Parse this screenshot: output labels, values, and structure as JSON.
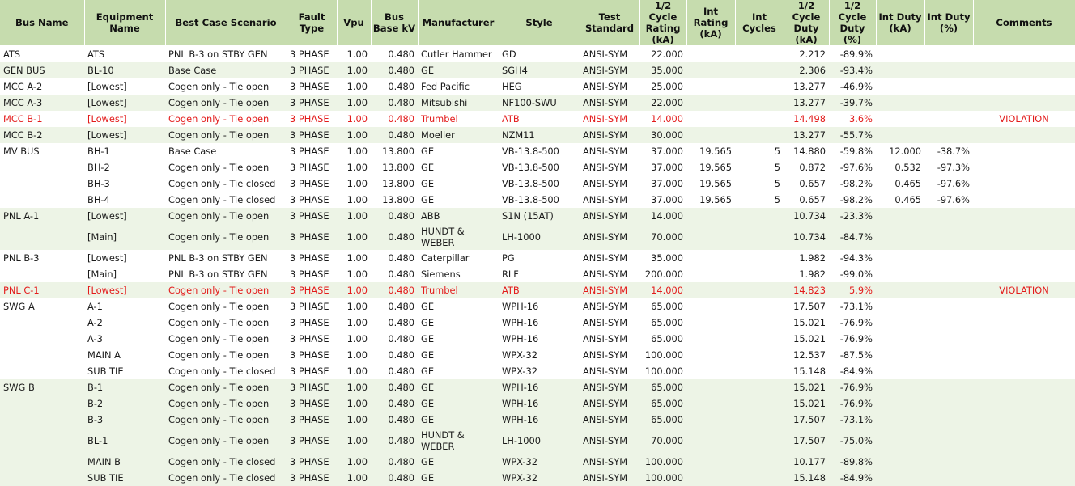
{
  "table": {
    "columns": [
      "Bus Name",
      "Equipment Name",
      "Best Case Scenario",
      "Fault Type",
      "Vpu",
      "Bus Base kV",
      "Manufacturer",
      "Style",
      "Test Standard",
      "1/2 Cycle Rating (kA)",
      "Int Rating (kA)",
      "Int Cycles",
      "1/2 Cycle Duty (kA)",
      "1/2 Cycle Duty (%)",
      "Int Duty (kA)",
      "Int Duty (%)",
      "Comments"
    ],
    "rows": [
      {
        "cells": [
          "ATS",
          "ATS",
          "PNL B-3 on STBY GEN",
          "3 PHASE",
          "1.00",
          "0.480",
          "Cutler Hammer",
          "GD",
          "ANSI-SYM",
          "22.000",
          "",
          "",
          "2.212",
          "-89.9%",
          "",
          "",
          ""
        ],
        "band": false,
        "violation": false,
        "tall": false
      },
      {
        "cells": [
          "GEN BUS",
          "BL-10",
          "Base Case",
          "3 PHASE",
          "1.00",
          "0.480",
          "GE",
          "SGH4",
          "ANSI-SYM",
          "35.000",
          "",
          "",
          "2.306",
          "-93.4%",
          "",
          "",
          ""
        ],
        "band": true,
        "violation": false,
        "tall": false
      },
      {
        "cells": [
          "MCC A-2",
          "[Lowest]",
          "Cogen only - Tie open",
          "3 PHASE",
          "1.00",
          "0.480",
          "Fed Pacific",
          "HEG",
          "ANSI-SYM",
          "25.000",
          "",
          "",
          "13.277",
          "-46.9%",
          "",
          "",
          ""
        ],
        "band": false,
        "violation": false,
        "tall": false
      },
      {
        "cells": [
          "MCC A-3",
          "[Lowest]",
          "Cogen only - Tie open",
          "3 PHASE",
          "1.00",
          "0.480",
          "Mitsubishi",
          "NF100-SWU",
          "ANSI-SYM",
          "22.000",
          "",
          "",
          "13.277",
          "-39.7%",
          "",
          "",
          ""
        ],
        "band": true,
        "violation": false,
        "tall": false
      },
      {
        "cells": [
          "MCC B-1",
          "[Lowest]",
          "Cogen only - Tie open",
          "3 PHASE",
          "1.00",
          "0.480",
          "Trumbel",
          "ATB",
          "ANSI-SYM",
          "14.000",
          "",
          "",
          "14.498",
          "3.6%",
          "",
          "",
          "VIOLATION"
        ],
        "band": false,
        "violation": true,
        "tall": false
      },
      {
        "cells": [
          "MCC B-2",
          "[Lowest]",
          "Cogen only - Tie open",
          "3 PHASE",
          "1.00",
          "0.480",
          "Moeller",
          "NZM11",
          "ANSI-SYM",
          "30.000",
          "",
          "",
          "13.277",
          "-55.7%",
          "",
          "",
          ""
        ],
        "band": true,
        "violation": false,
        "tall": false
      },
      {
        "cells": [
          "MV BUS",
          "BH-1",
          "Base Case",
          "3 PHASE",
          "1.00",
          "13.800",
          "GE",
          "VB-13.8-500",
          "ANSI-SYM",
          "37.000",
          "19.565",
          "5",
          "14.880",
          "-59.8%",
          "12.000",
          "-38.7%",
          ""
        ],
        "band": false,
        "violation": false,
        "tall": false
      },
      {
        "cells": [
          "",
          "BH-2",
          "Cogen only - Tie open",
          "3 PHASE",
          "1.00",
          "13.800",
          "GE",
          "VB-13.8-500",
          "ANSI-SYM",
          "37.000",
          "19.565",
          "5",
          "0.872",
          "-97.6%",
          "0.532",
          "-97.3%",
          ""
        ],
        "band": false,
        "violation": false,
        "tall": false
      },
      {
        "cells": [
          "",
          "BH-3",
          "Cogen only - Tie closed",
          "3 PHASE",
          "1.00",
          "13.800",
          "GE",
          "VB-13.8-500",
          "ANSI-SYM",
          "37.000",
          "19.565",
          "5",
          "0.657",
          "-98.2%",
          "0.465",
          "-97.6%",
          ""
        ],
        "band": false,
        "violation": false,
        "tall": false
      },
      {
        "cells": [
          "",
          "BH-4",
          "Cogen only - Tie closed",
          "3 PHASE",
          "1.00",
          "13.800",
          "GE",
          "VB-13.8-500",
          "ANSI-SYM",
          "37.000",
          "19.565",
          "5",
          "0.657",
          "-98.2%",
          "0.465",
          "-97.6%",
          ""
        ],
        "band": false,
        "violation": false,
        "tall": false
      },
      {
        "cells": [
          "PNL A-1",
          "[Lowest]",
          "Cogen only - Tie open",
          "3 PHASE",
          "1.00",
          "0.480",
          "ABB",
          "S1N (15AT)",
          "ANSI-SYM",
          "14.000",
          "",
          "",
          "10.734",
          "-23.3%",
          "",
          "",
          ""
        ],
        "band": true,
        "violation": false,
        "tall": false
      },
      {
        "cells": [
          "",
          "[Main]",
          "Cogen only - Tie open",
          "3 PHASE",
          "1.00",
          "0.480",
          "HUNDT & WEBER",
          "LH-1000",
          "ANSI-SYM",
          "70.000",
          "",
          "",
          "10.734",
          "-84.7%",
          "",
          "",
          ""
        ],
        "band": true,
        "violation": false,
        "tall": true
      },
      {
        "cells": [
          "PNL B-3",
          "[Lowest]",
          "PNL B-3 on STBY GEN",
          "3 PHASE",
          "1.00",
          "0.480",
          "Caterpillar",
          "PG",
          "ANSI-SYM",
          "35.000",
          "",
          "",
          "1.982",
          "-94.3%",
          "",
          "",
          ""
        ],
        "band": false,
        "violation": false,
        "tall": false
      },
      {
        "cells": [
          "",
          "[Main]",
          "PNL B-3 on STBY GEN",
          "3 PHASE",
          "1.00",
          "0.480",
          "Siemens",
          "RLF",
          "ANSI-SYM",
          "200.000",
          "",
          "",
          "1.982",
          "-99.0%",
          "",
          "",
          ""
        ],
        "band": false,
        "violation": false,
        "tall": false
      },
      {
        "cells": [
          "PNL C-1",
          "[Lowest]",
          "Cogen only - Tie open",
          "3 PHASE",
          "1.00",
          "0.480",
          "Trumbel",
          "ATB",
          "ANSI-SYM",
          "14.000",
          "",
          "",
          "14.823",
          "5.9%",
          "",
          "",
          "VIOLATION"
        ],
        "band": true,
        "violation": true,
        "tall": false
      },
      {
        "cells": [
          "SWG A",
          "A-1",
          "Cogen only - Tie open",
          "3 PHASE",
          "1.00",
          "0.480",
          "GE",
          "WPH-16",
          "ANSI-SYM",
          "65.000",
          "",
          "",
          "17.507",
          "-73.1%",
          "",
          "",
          ""
        ],
        "band": false,
        "violation": false,
        "tall": false
      },
      {
        "cells": [
          "",
          "A-2",
          "Cogen only - Tie open",
          "3 PHASE",
          "1.00",
          "0.480",
          "GE",
          "WPH-16",
          "ANSI-SYM",
          "65.000",
          "",
          "",
          "15.021",
          "-76.9%",
          "",
          "",
          ""
        ],
        "band": false,
        "violation": false,
        "tall": false
      },
      {
        "cells": [
          "",
          "A-3",
          "Cogen only - Tie open",
          "3 PHASE",
          "1.00",
          "0.480",
          "GE",
          "WPH-16",
          "ANSI-SYM",
          "65.000",
          "",
          "",
          "15.021",
          "-76.9%",
          "",
          "",
          ""
        ],
        "band": false,
        "violation": false,
        "tall": false
      },
      {
        "cells": [
          "",
          "MAIN A",
          "Cogen only - Tie open",
          "3 PHASE",
          "1.00",
          "0.480",
          "GE",
          "WPX-32",
          "ANSI-SYM",
          "100.000",
          "",
          "",
          "12.537",
          "-87.5%",
          "",
          "",
          ""
        ],
        "band": false,
        "violation": false,
        "tall": false
      },
      {
        "cells": [
          "",
          "SUB TIE",
          "Cogen only - Tie closed",
          "3 PHASE",
          "1.00",
          "0.480",
          "GE",
          "WPX-32",
          "ANSI-SYM",
          "100.000",
          "",
          "",
          "15.148",
          "-84.9%",
          "",
          "",
          ""
        ],
        "band": false,
        "violation": false,
        "tall": false
      },
      {
        "cells": [
          "SWG B",
          "B-1",
          "Cogen only - Tie open",
          "3 PHASE",
          "1.00",
          "0.480",
          "GE",
          "WPH-16",
          "ANSI-SYM",
          "65.000",
          "",
          "",
          "15.021",
          "-76.9%",
          "",
          "",
          ""
        ],
        "band": true,
        "violation": false,
        "tall": false
      },
      {
        "cells": [
          "",
          "B-2",
          "Cogen only - Tie open",
          "3 PHASE",
          "1.00",
          "0.480",
          "GE",
          "WPH-16",
          "ANSI-SYM",
          "65.000",
          "",
          "",
          "15.021",
          "-76.9%",
          "",
          "",
          ""
        ],
        "band": true,
        "violation": false,
        "tall": false
      },
      {
        "cells": [
          "",
          "B-3",
          "Cogen only - Tie open",
          "3 PHASE",
          "1.00",
          "0.480",
          "GE",
          "WPH-16",
          "ANSI-SYM",
          "65.000",
          "",
          "",
          "17.507",
          "-73.1%",
          "",
          "",
          ""
        ],
        "band": true,
        "violation": false,
        "tall": false
      },
      {
        "cells": [
          "",
          "BL-1",
          "Cogen only - Tie open",
          "3 PHASE",
          "1.00",
          "0.480",
          "HUNDT & WEBER",
          "LH-1000",
          "ANSI-SYM",
          "70.000",
          "",
          "",
          "17.507",
          "-75.0%",
          "",
          "",
          ""
        ],
        "band": true,
        "violation": false,
        "tall": true
      },
      {
        "cells": [
          "",
          "MAIN B",
          "Cogen only - Tie closed",
          "3 PHASE",
          "1.00",
          "0.480",
          "GE",
          "WPX-32",
          "ANSI-SYM",
          "100.000",
          "",
          "",
          "10.177",
          "-89.8%",
          "",
          "",
          ""
        ],
        "band": true,
        "violation": false,
        "tall": false
      },
      {
        "cells": [
          "",
          "SUB TIE",
          "Cogen only - Tie closed",
          "3 PHASE",
          "1.00",
          "0.480",
          "GE",
          "WPX-32",
          "ANSI-SYM",
          "100.000",
          "",
          "",
          "15.148",
          "-84.9%",
          "",
          "",
          ""
        ],
        "band": true,
        "violation": false,
        "tall": false
      }
    ]
  },
  "colors": {
    "header_bg": "#c6dcae",
    "band_bg": "#edf4e6",
    "violation_text": "#e31b1b"
  }
}
